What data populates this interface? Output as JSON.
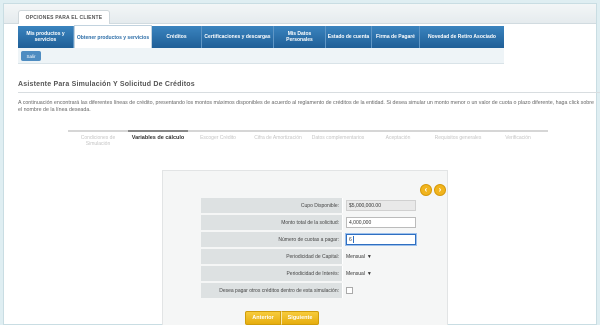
{
  "header": {
    "section_tab": "OPCIONES PARA EL CLIENTE"
  },
  "nav": {
    "items": [
      {
        "label": "Mis productos y servicios"
      },
      {
        "label": "Obtener productos y servicios"
      },
      {
        "label": "Créditos"
      },
      {
        "label": "Certificaciones y descargas"
      },
      {
        "label": "Mis Datos Personales"
      },
      {
        "label": "Estado de cuenta"
      },
      {
        "label": "Firma de Pagaré"
      },
      {
        "label": "Novedad de Retiro Asociado"
      }
    ],
    "active_index": 1
  },
  "subnav": {
    "button_label": "Salir"
  },
  "page": {
    "title": "Asistente Para Simulación Y Solicitud De Créditos",
    "description": "A continuación encontrará las diferentes líneas de crédito, presentando los montos máximos disponibles de acuerdo al reglamento de créditos de la entidad. Si desea simular un monto menor o un valor de cuota o plazo diferente, haga click sobre el nombre de la línea deseada."
  },
  "steps": [
    {
      "label": "Condiciones de Simulación",
      "active": false
    },
    {
      "label": "Variables de cálculo",
      "active": true
    },
    {
      "label": "Escoger Crédito",
      "active": false
    },
    {
      "label": "Cifra de Amortización",
      "active": false
    },
    {
      "label": "Datos complementarios",
      "active": false
    },
    {
      "label": "Aceptación",
      "active": false
    },
    {
      "label": "Requisitos generales",
      "active": false
    },
    {
      "label": "Verificación",
      "active": false
    }
  ],
  "form": {
    "fields": [
      {
        "label": "Cupo Disponible:",
        "value": "$5,000,000.00",
        "kind": "readonly"
      },
      {
        "label": "Monto total de la solicitud:",
        "value": "4,000,000",
        "kind": "input"
      },
      {
        "label": "Número de cuotas a pagar:",
        "value": "6",
        "kind": "focus"
      },
      {
        "label": "Periodicidad de Capital:",
        "value": "Mensual",
        "kind": "select"
      },
      {
        "label": "Periodicidad de Interés:",
        "value": "Mensual",
        "kind": "select"
      },
      {
        "label": "Desea pagar otros créditos dentro de esta simulación:",
        "value": "",
        "kind": "checkbox"
      }
    ],
    "back_label": "Anterior",
    "next_label": "Siguiente"
  },
  "colors": {
    "nav_blue": "#2d6ea8",
    "accent_yellow": "#f1b41d"
  },
  "icons": {
    "prev": "chevron-left-icon",
    "next": "chevron-right-icon"
  }
}
